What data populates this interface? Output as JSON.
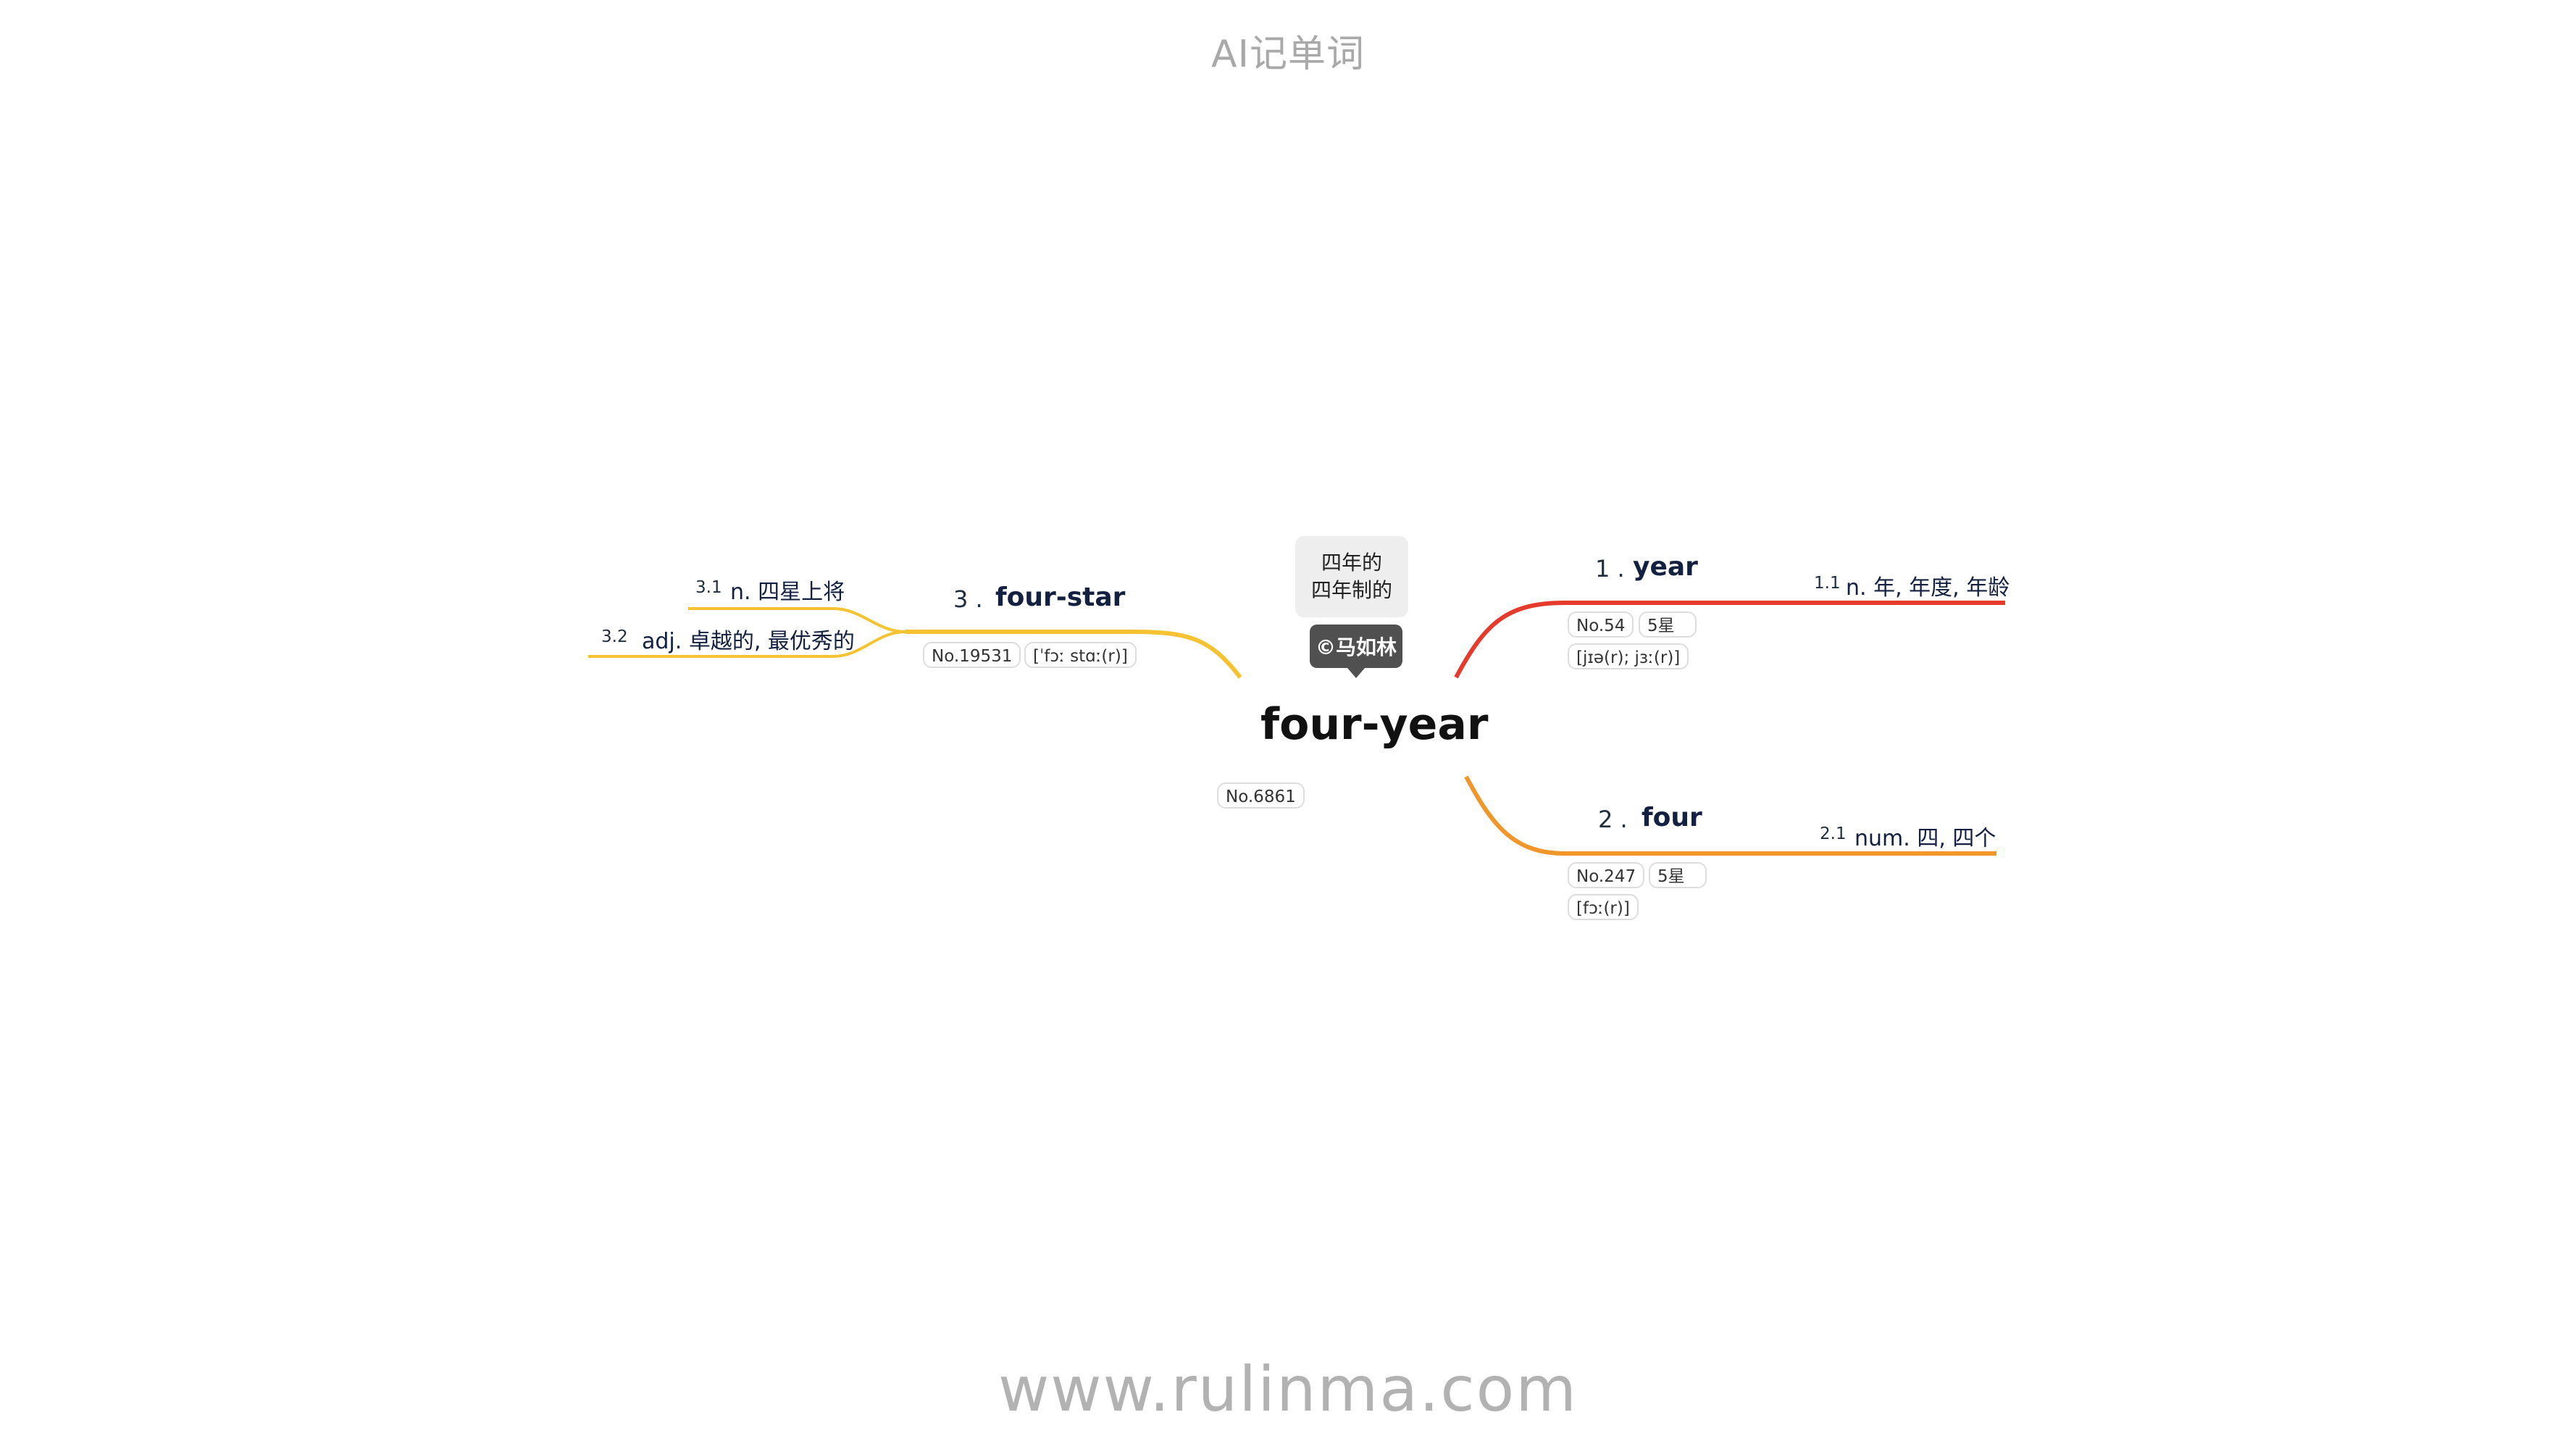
{
  "header": {
    "title": "AI记单词"
  },
  "footer": {
    "watermark": "www.rulinma.com"
  },
  "center": {
    "word": "four-year",
    "rank": "No.6861",
    "meanings": [
      "四年的",
      "四年制的"
    ],
    "author": "©马如林"
  },
  "branches": [
    {
      "num": "1 .",
      "word": "year",
      "rank": "No.54",
      "stars": "5星",
      "phonetic": "[jɪə(r); jɜː(r)]",
      "color": "#e53b2c",
      "senses": [
        {
          "num": "1.1",
          "text": "n. 年, 年度, 年龄"
        }
      ]
    },
    {
      "num": "2 .",
      "word": "four",
      "rank": "No.247",
      "stars": "5星",
      "phonetic": "[fɔː(r)]",
      "color": "#f0962b",
      "senses": [
        {
          "num": "2.1",
          "text": "num. 四, 四个"
        }
      ]
    },
    {
      "num": "3 .",
      "word": "four-star",
      "rank": "No.19531",
      "phonetic": "[ˈfɔː stɑː(r)]",
      "color": "#f5c332",
      "senses": [
        {
          "num": "3.1",
          "text": "n. 四星上将"
        },
        {
          "num": "3.2",
          "text": "adj. 卓越的, 最优秀的"
        }
      ]
    }
  ]
}
